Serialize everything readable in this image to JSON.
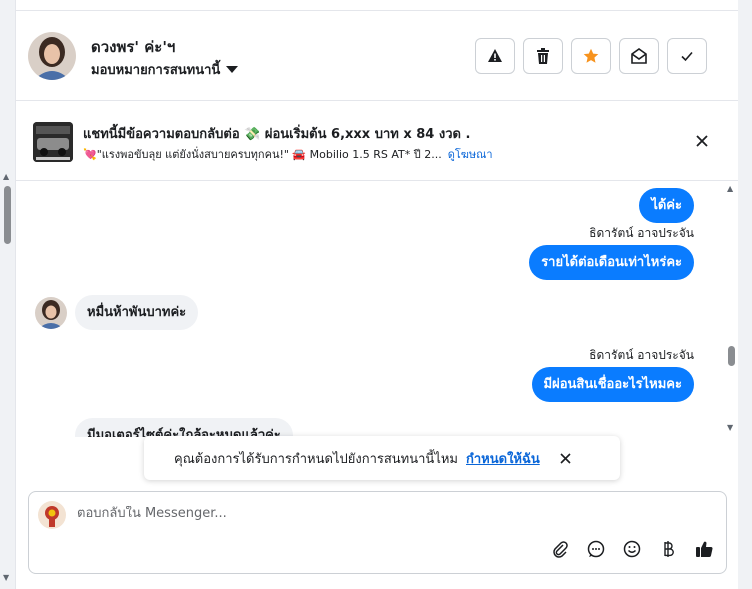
{
  "contact": {
    "name": "ดวงพร' ค่ะ'ฯ",
    "assign_label": "มอบหมายการสนทนานี้"
  },
  "actions": [
    {
      "name": "warning-icon"
    },
    {
      "name": "trash-icon"
    },
    {
      "name": "star-icon",
      "color": "#f7931e"
    },
    {
      "name": "mark-unread-icon"
    },
    {
      "name": "check-icon"
    }
  ],
  "ad": {
    "title": "แชทนี้มีข้อความตอบกลับต่อ 💸 ผ่อนเริ่มต้น 6,xxx บาท x 84 งวด .",
    "subtitle": "💘\"แรงพอขับลุย แต่ยังนั่งสบายครบทุกคน!\" 🚘 Mobilio 1.5 RS AT* ปี 2...",
    "link_label": "ดูโฆษณา"
  },
  "messages": [
    {
      "dir": "out",
      "text": "ได้ค่ะ"
    },
    {
      "dir": "out",
      "sender": "ธิดารัตน์ อาจประจัน",
      "text": "รายได้ต่อเดือนเท่าไหร่คะ"
    },
    {
      "dir": "in",
      "text": "หมื่นห้าพันบาทค่ะ"
    },
    {
      "dir": "out",
      "sender": "ธิดารัตน์ อาจประจัน",
      "text": "มีผ่อนสินเชื่ออะไรไหมคะ"
    },
    {
      "dir": "in",
      "text": "มีมอเตอร์ไซต์ค่ะใกล้จะหมดแล้วค่ะ"
    }
  ],
  "toast": {
    "text": "คุณต้องการได้รับการกำหนดไปยังการสนทนานี้ไหม",
    "link_label": "กำหนดให้ฉัน"
  },
  "composer": {
    "placeholder": "ตอบกลับใน Messenger..."
  },
  "composer_tools": [
    "paperclip-icon",
    "chat-bubble-icon",
    "smiley-icon",
    "baht-icon",
    "thumbs-up-icon"
  ],
  "colors": {
    "accent": "#0a7cff",
    "link": "#0a66d8",
    "incoming_bubble": "#f0f2f5"
  }
}
